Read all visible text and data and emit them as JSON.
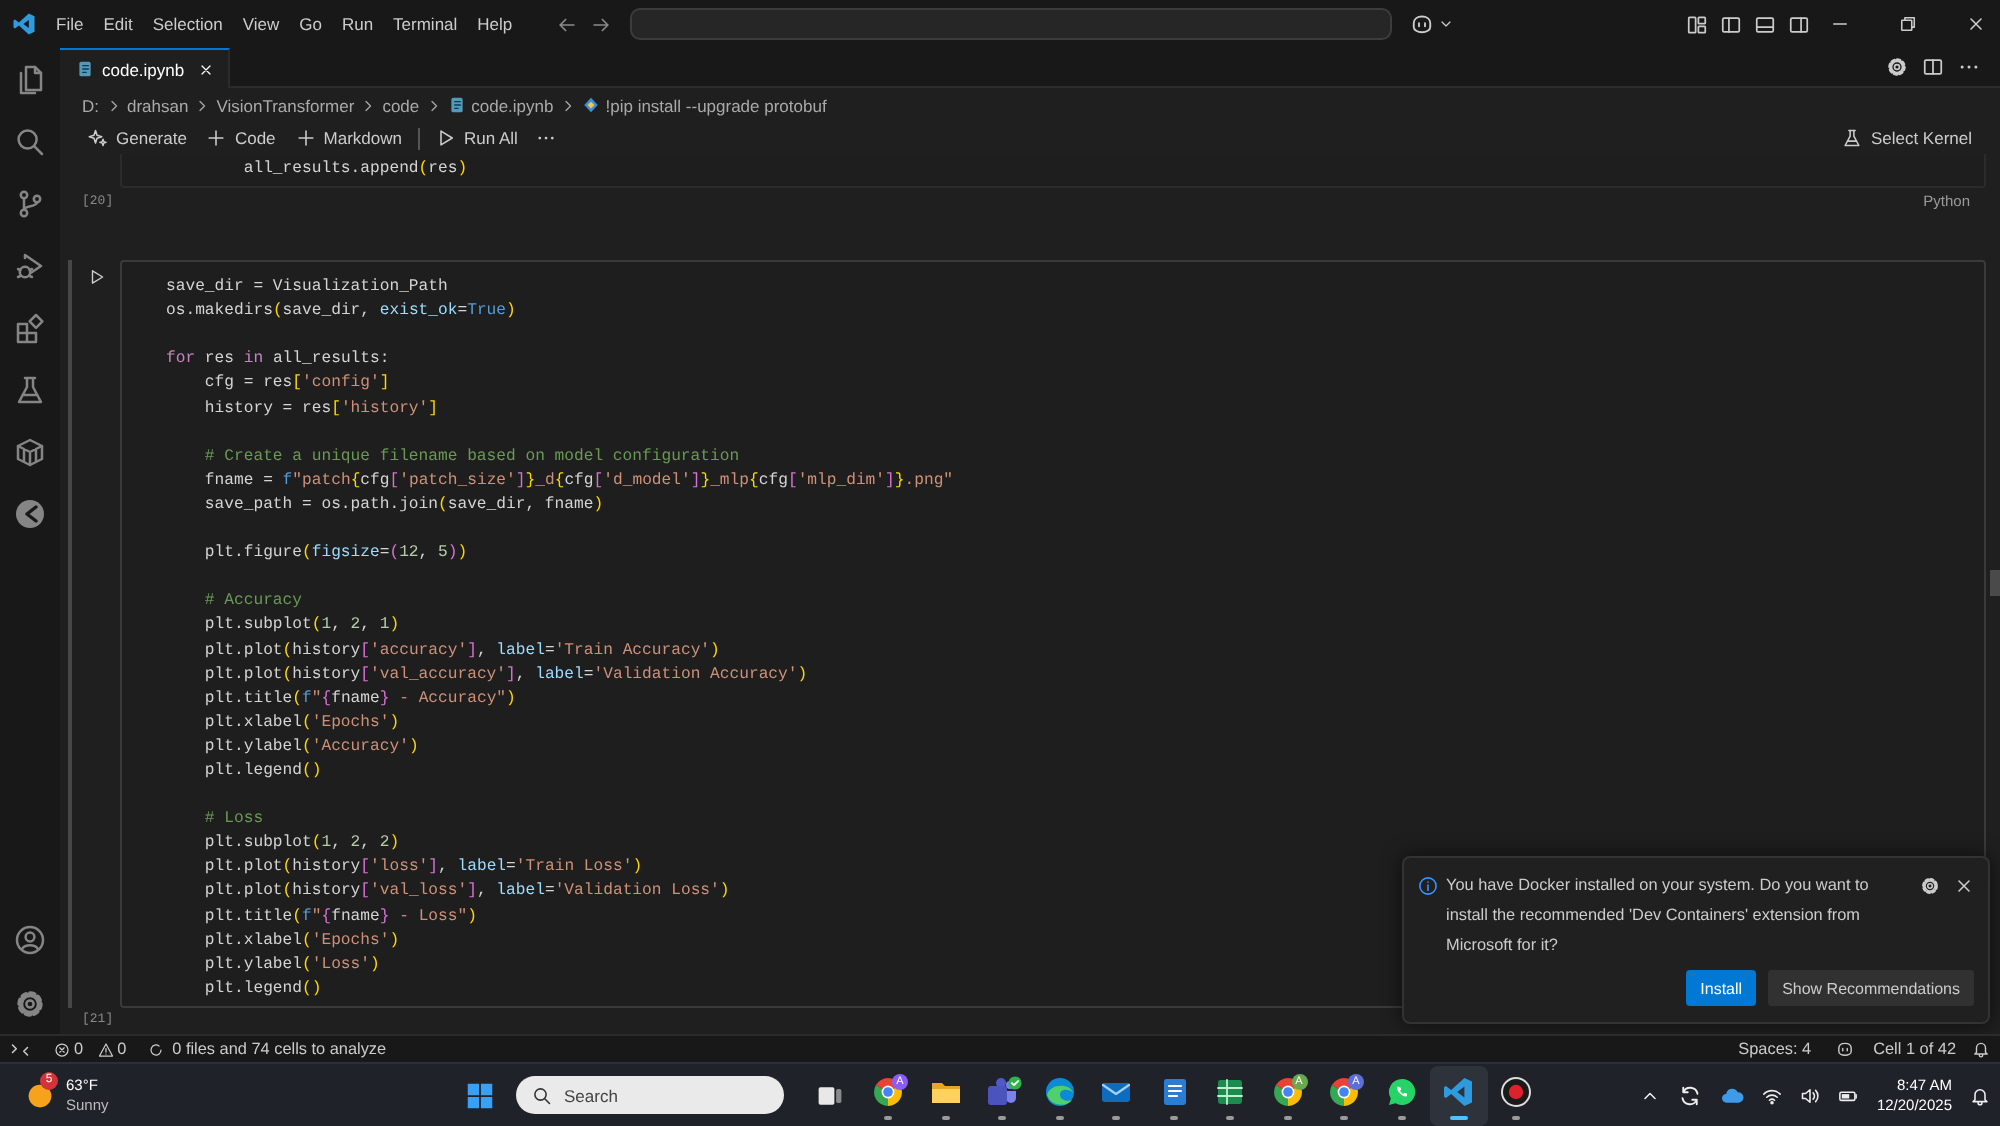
{
  "window": {
    "menus": [
      "File",
      "Edit",
      "Selection",
      "View",
      "Go",
      "Run",
      "Terminal",
      "Help"
    ]
  },
  "tabs": [
    {
      "label": "code.ipynb",
      "selected": true
    }
  ],
  "breadcrumbs": [
    {
      "label": "D:",
      "kind": "folder"
    },
    {
      "label": "drahsan",
      "kind": "folder"
    },
    {
      "label": "VisionTransformer",
      "kind": "folder"
    },
    {
      "label": "code",
      "kind": "folder"
    },
    {
      "label": "code.ipynb",
      "kind": "notebook"
    },
    {
      "label": "!pip install --upgrade protobuf",
      "kind": "cell"
    }
  ],
  "toolbar": {
    "actions": [
      {
        "label": "Generate",
        "kind": "generate"
      },
      {
        "label": "Code",
        "kind": "add"
      },
      {
        "label": "Markdown",
        "kind": "add"
      },
      {
        "label": "Run All",
        "kind": "run"
      }
    ],
    "kernel": "Select Kernel"
  },
  "cells": [
    {
      "selected": false,
      "execution": "[20]",
      "language": "Python",
      "lines": [
        {
          "kind": "code",
          "tokens": [
            {
              "kind": "plain",
              "text": "        all_results.append"
            },
            {
              "kind": "br1",
              "text": "("
            },
            {
              "kind": "plain",
              "text": "res"
            },
            {
              "kind": "br1",
              "text": ")"
            }
          ]
        }
      ]
    },
    {
      "selected": true,
      "execution": "[21]",
      "lines": [
        {
          "kind": "code",
          "tokens": [
            {
              "kind": "plain",
              "text": "save_dir = Visualization_Path"
            }
          ]
        },
        {
          "kind": "code",
          "tokens": [
            {
              "kind": "plain",
              "text": "os.makedirs"
            },
            {
              "kind": "br1",
              "text": "("
            },
            {
              "kind": "plain",
              "text": "save_dir, "
            },
            {
              "kind": "param",
              "text": "exist_ok"
            },
            {
              "kind": "plain",
              "text": "="
            },
            {
              "kind": "const",
              "text": "True"
            },
            {
              "kind": "br1",
              "text": ")"
            }
          ]
        },
        {
          "kind": "blank"
        },
        {
          "kind": "code",
          "tokens": [
            {
              "kind": "kw",
              "text": "for"
            },
            {
              "kind": "plain",
              "text": " res "
            },
            {
              "kind": "kw",
              "text": "in"
            },
            {
              "kind": "plain",
              "text": " all_results:"
            }
          ]
        },
        {
          "kind": "code",
          "tokens": [
            {
              "kind": "plain",
              "text": "    cfg = res"
            },
            {
              "kind": "br1",
              "text": "["
            },
            {
              "kind": "str",
              "text": "'config'"
            },
            {
              "kind": "br1",
              "text": "]"
            }
          ]
        },
        {
          "kind": "code",
          "tokens": [
            {
              "kind": "plain",
              "text": "    history = res"
            },
            {
              "kind": "br1",
              "text": "["
            },
            {
              "kind": "str",
              "text": "'history'"
            },
            {
              "kind": "br1",
              "text": "]"
            }
          ]
        },
        {
          "kind": "blank"
        },
        {
          "kind": "code",
          "tokens": [
            {
              "kind": "comment",
              "text": "    # Create a unique filename based on model configuration"
            }
          ]
        },
        {
          "kind": "code",
          "tokens": [
            {
              "kind": "plain",
              "text": "    fname = "
            },
            {
              "kind": "const",
              "text": "f"
            },
            {
              "kind": "str",
              "text": "\"patch"
            },
            {
              "kind": "br1",
              "text": "{"
            },
            {
              "kind": "plain",
              "text": "cfg"
            },
            {
              "kind": "br2",
              "text": "["
            },
            {
              "kind": "str",
              "text": "'patch_size'"
            },
            {
              "kind": "br2",
              "text": "]"
            },
            {
              "kind": "br1",
              "text": "}"
            },
            {
              "kind": "str",
              "text": "_d"
            },
            {
              "kind": "br1",
              "text": "{"
            },
            {
              "kind": "plain",
              "text": "cfg"
            },
            {
              "kind": "br2",
              "text": "["
            },
            {
              "kind": "str",
              "text": "'d_model'"
            },
            {
              "kind": "br2",
              "text": "]"
            },
            {
              "kind": "br1",
              "text": "}"
            },
            {
              "kind": "str",
              "text": "_mlp"
            },
            {
              "kind": "br1",
              "text": "{"
            },
            {
              "kind": "plain",
              "text": "cfg"
            },
            {
              "kind": "br2",
              "text": "["
            },
            {
              "kind": "str",
              "text": "'mlp_dim'"
            },
            {
              "kind": "br2",
              "text": "]"
            },
            {
              "kind": "br1",
              "text": "}"
            },
            {
              "kind": "str",
              "text": ".png\""
            }
          ]
        },
        {
          "kind": "code",
          "tokens": [
            {
              "kind": "plain",
              "text": "    save_path = os.path.join"
            },
            {
              "kind": "br1",
              "text": "("
            },
            {
              "kind": "plain",
              "text": "save_dir, fname"
            },
            {
              "kind": "br1",
              "text": ")"
            }
          ]
        },
        {
          "kind": "blank"
        },
        {
          "kind": "code",
          "tokens": [
            {
              "kind": "plain",
              "text": "    plt.figure"
            },
            {
              "kind": "br1",
              "text": "("
            },
            {
              "kind": "param",
              "text": "figsize"
            },
            {
              "kind": "plain",
              "text": "="
            },
            {
              "kind": "br2",
              "text": "("
            },
            {
              "kind": "num",
              "text": "12"
            },
            {
              "kind": "plain",
              "text": ", "
            },
            {
              "kind": "num",
              "text": "5"
            },
            {
              "kind": "br2",
              "text": ")"
            },
            {
              "kind": "br1",
              "text": ")"
            }
          ]
        },
        {
          "kind": "blank"
        },
        {
          "kind": "code",
          "tokens": [
            {
              "kind": "comment",
              "text": "    # Accuracy"
            }
          ]
        },
        {
          "kind": "code",
          "tokens": [
            {
              "kind": "plain",
              "text": "    plt.subplot"
            },
            {
              "kind": "br1",
              "text": "("
            },
            {
              "kind": "num",
              "text": "1"
            },
            {
              "kind": "plain",
              "text": ", "
            },
            {
              "kind": "num",
              "text": "2"
            },
            {
              "kind": "plain",
              "text": ", "
            },
            {
              "kind": "num",
              "text": "1"
            },
            {
              "kind": "br1",
              "text": ")"
            }
          ]
        },
        {
          "kind": "code",
          "tokens": [
            {
              "kind": "plain",
              "text": "    plt.plot"
            },
            {
              "kind": "br1",
              "text": "("
            },
            {
              "kind": "plain",
              "text": "history"
            },
            {
              "kind": "br2",
              "text": "["
            },
            {
              "kind": "str",
              "text": "'accuracy'"
            },
            {
              "kind": "br2",
              "text": "]"
            },
            {
              "kind": "plain",
              "text": ", "
            },
            {
              "kind": "param",
              "text": "label"
            },
            {
              "kind": "plain",
              "text": "="
            },
            {
              "kind": "str",
              "text": "'Train Accuracy'"
            },
            {
              "kind": "br1",
              "text": ")"
            }
          ]
        },
        {
          "kind": "code",
          "tokens": [
            {
              "kind": "plain",
              "text": "    plt.plot"
            },
            {
              "kind": "br1",
              "text": "("
            },
            {
              "kind": "plain",
              "text": "history"
            },
            {
              "kind": "br2",
              "text": "["
            },
            {
              "kind": "str",
              "text": "'val_accuracy'"
            },
            {
              "kind": "br2",
              "text": "]"
            },
            {
              "kind": "plain",
              "text": ", "
            },
            {
              "kind": "param",
              "text": "label"
            },
            {
              "kind": "plain",
              "text": "="
            },
            {
              "kind": "str",
              "text": "'Validation Accuracy'"
            },
            {
              "kind": "br1",
              "text": ")"
            }
          ]
        },
        {
          "kind": "code",
          "tokens": [
            {
              "kind": "plain",
              "text": "    plt.title"
            },
            {
              "kind": "br1",
              "text": "("
            },
            {
              "kind": "const",
              "text": "f"
            },
            {
              "kind": "str",
              "text": "\""
            },
            {
              "kind": "br2",
              "text": "{"
            },
            {
              "kind": "plain",
              "text": "fname"
            },
            {
              "kind": "br2",
              "text": "}"
            },
            {
              "kind": "str",
              "text": " - Accuracy\""
            },
            {
              "kind": "br1",
              "text": ")"
            }
          ]
        },
        {
          "kind": "code",
          "tokens": [
            {
              "kind": "plain",
              "text": "    plt.xlabel"
            },
            {
              "kind": "br1",
              "text": "("
            },
            {
              "kind": "str",
              "text": "'Epochs'"
            },
            {
              "kind": "br1",
              "text": ")"
            }
          ]
        },
        {
          "kind": "code",
          "tokens": [
            {
              "kind": "plain",
              "text": "    plt.ylabel"
            },
            {
              "kind": "br1",
              "text": "("
            },
            {
              "kind": "str",
              "text": "'Accuracy'"
            },
            {
              "kind": "br1",
              "text": ")"
            }
          ]
        },
        {
          "kind": "code",
          "tokens": [
            {
              "kind": "plain",
              "text": "    plt.legend"
            },
            {
              "kind": "br1",
              "text": "()"
            }
          ]
        },
        {
          "kind": "blank"
        },
        {
          "kind": "code",
          "tokens": [
            {
              "kind": "comment",
              "text": "    # Loss"
            }
          ]
        },
        {
          "kind": "code",
          "tokens": [
            {
              "kind": "plain",
              "text": "    plt.subplot"
            },
            {
              "kind": "br1",
              "text": "("
            },
            {
              "kind": "num",
              "text": "1"
            },
            {
              "kind": "plain",
              "text": ", "
            },
            {
              "kind": "num",
              "text": "2"
            },
            {
              "kind": "plain",
              "text": ", "
            },
            {
              "kind": "num",
              "text": "2"
            },
            {
              "kind": "br1",
              "text": ")"
            }
          ]
        },
        {
          "kind": "code",
          "tokens": [
            {
              "kind": "plain",
              "text": "    plt.plot"
            },
            {
              "kind": "br1",
              "text": "("
            },
            {
              "kind": "plain",
              "text": "history"
            },
            {
              "kind": "br2",
              "text": "["
            },
            {
              "kind": "str",
              "text": "'loss'"
            },
            {
              "kind": "br2",
              "text": "]"
            },
            {
              "kind": "plain",
              "text": ", "
            },
            {
              "kind": "param",
              "text": "label"
            },
            {
              "kind": "plain",
              "text": "="
            },
            {
              "kind": "str",
              "text": "'Train Loss'"
            },
            {
              "kind": "br1",
              "text": ")"
            }
          ]
        },
        {
          "kind": "code",
          "tokens": [
            {
              "kind": "plain",
              "text": "    plt.plot"
            },
            {
              "kind": "br1",
              "text": "("
            },
            {
              "kind": "plain",
              "text": "history"
            },
            {
              "kind": "br2",
              "text": "["
            },
            {
              "kind": "str",
              "text": "'val_loss'"
            },
            {
              "kind": "br2",
              "text": "]"
            },
            {
              "kind": "plain",
              "text": ", "
            },
            {
              "kind": "param",
              "text": "label"
            },
            {
              "kind": "plain",
              "text": "="
            },
            {
              "kind": "str",
              "text": "'Validation Loss'"
            },
            {
              "kind": "br1",
              "text": ")"
            }
          ]
        },
        {
          "kind": "code",
          "tokens": [
            {
              "kind": "plain",
              "text": "    plt.title"
            },
            {
              "kind": "br1",
              "text": "("
            },
            {
              "kind": "const",
              "text": "f"
            },
            {
              "kind": "str",
              "text": "\""
            },
            {
              "kind": "br2",
              "text": "{"
            },
            {
              "kind": "plain",
              "text": "fname"
            },
            {
              "kind": "br2",
              "text": "}"
            },
            {
              "kind": "str",
              "text": " - Loss\""
            },
            {
              "kind": "br1",
              "text": ")"
            }
          ]
        },
        {
          "kind": "code",
          "tokens": [
            {
              "kind": "plain",
              "text": "    plt.xlabel"
            },
            {
              "kind": "br1",
              "text": "("
            },
            {
              "kind": "str",
              "text": "'Epochs'"
            },
            {
              "kind": "br1",
              "text": ")"
            }
          ]
        },
        {
          "kind": "code",
          "tokens": [
            {
              "kind": "plain",
              "text": "    plt.ylabel"
            },
            {
              "kind": "br1",
              "text": "("
            },
            {
              "kind": "str",
              "text": "'Loss'"
            },
            {
              "kind": "br1",
              "text": ")"
            }
          ]
        },
        {
          "kind": "code",
          "tokens": [
            {
              "kind": "plain",
              "text": "    plt.legend"
            },
            {
              "kind": "br1",
              "text": "()"
            }
          ]
        }
      ]
    }
  ],
  "notification": {
    "message": "You have Docker installed on your system. Do you want to install the recommended 'Dev Containers' extension from Microsoft for it?",
    "buttons": [
      {
        "label": "Install",
        "primary": true
      },
      {
        "label": "Show Recommendations",
        "primary": false
      }
    ]
  },
  "status_bar": {
    "errors": "0",
    "warnings": "0",
    "analysis": "0 files and 74 cells to analyze",
    "indentation": "Spaces: 4",
    "cell_position": "Cell 1 of 42"
  },
  "taskbar": {
    "weather": {
      "badge": "5",
      "temperature": "63°F",
      "condition": "Sunny"
    },
    "search": {
      "placeholder": "Search"
    },
    "apps": [
      {
        "kind": "browser",
        "badge": "A",
        "color": "#8b5cf6",
        "running": true,
        "selected": false
      },
      {
        "kind": "folder",
        "running": true,
        "selected": false
      },
      {
        "kind": "meeting",
        "running": true,
        "selected": false
      },
      {
        "kind": "web",
        "running": true,
        "selected": false
      },
      {
        "kind": "mail",
        "running": true,
        "selected": false
      },
      {
        "kind": "document",
        "running": true,
        "selected": false
      },
      {
        "kind": "spreadsheet",
        "running": true,
        "selected": false
      },
      {
        "kind": "browser",
        "badge": "A",
        "color": "#6aa84f",
        "running": true,
        "selected": false
      },
      {
        "kind": "browser",
        "badge": "A",
        "color": "#5b6fd6",
        "running": true,
        "selected": false
      },
      {
        "kind": "chat",
        "running": true,
        "selected": false
      },
      {
        "kind": "editor",
        "running": true,
        "selected": true
      },
      {
        "kind": "record",
        "running": true,
        "selected": false
      }
    ],
    "clock": {
      "time": "8:47 AM",
      "date": "12/20/2025"
    }
  }
}
